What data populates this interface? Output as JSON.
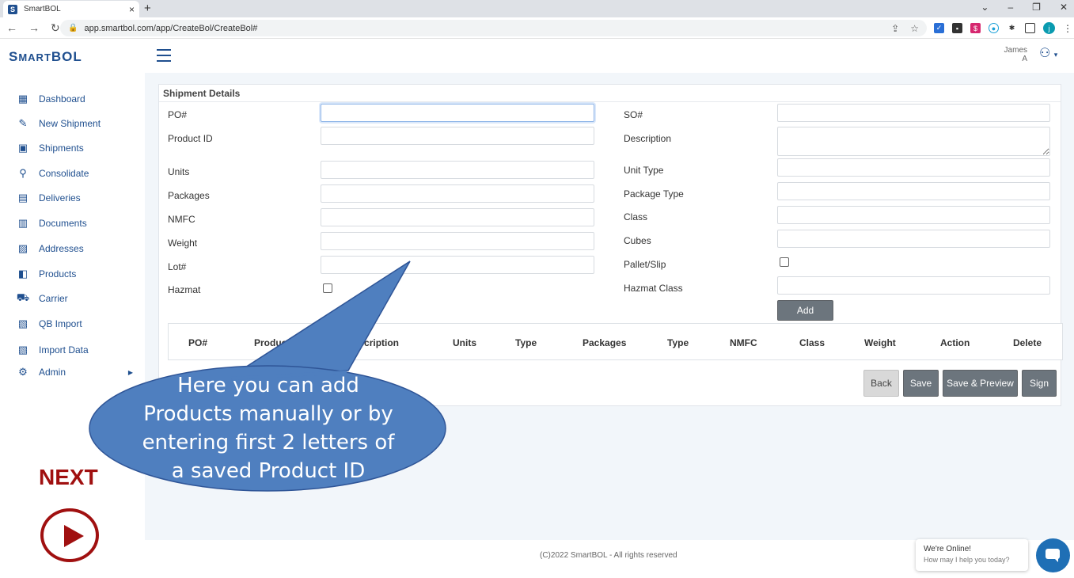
{
  "browser": {
    "tab_favicon": "S",
    "tab_title": "SmartBOL",
    "tab_close": "×",
    "new_tab": "+",
    "url": "app.smartbol.com/app/CreateBol/CreateBol#",
    "profile_initial": "j",
    "window_controls": [
      "⌄",
      "–",
      "❐",
      "✕"
    ]
  },
  "app": {
    "logo_first": "S",
    "logo_mid": "MART",
    "logo_last": "BOL",
    "user_first": "James",
    "user_last": "A"
  },
  "sidebar": {
    "items": [
      {
        "label": "Dashboard",
        "icon": "dashboard-icon",
        "glyph": "▦"
      },
      {
        "label": "New Shipment",
        "icon": "edit-icon",
        "glyph": "✎"
      },
      {
        "label": "Shipments",
        "icon": "boxes-icon",
        "glyph": "▣"
      },
      {
        "label": "Consolidate",
        "icon": "sitemap-icon",
        "glyph": "⚲"
      },
      {
        "label": "Deliveries",
        "icon": "calendar-icon",
        "glyph": "▤"
      },
      {
        "label": "Documents",
        "icon": "document-icon",
        "glyph": "▥"
      },
      {
        "label": "Addresses",
        "icon": "address-card-icon",
        "glyph": "▨"
      },
      {
        "label": "Products",
        "icon": "box-open-icon",
        "glyph": "◧"
      },
      {
        "label": "Carrier",
        "icon": "truck-icon",
        "glyph": "⛟"
      },
      {
        "label": "QB Import",
        "icon": "file-import-icon",
        "glyph": "▧"
      },
      {
        "label": "Import Data",
        "icon": "file-import-icon",
        "glyph": "▧"
      },
      {
        "label": "Admin",
        "icon": "users-cog-icon",
        "glyph": "⚙"
      }
    ],
    "next_label": "NEXT"
  },
  "form": {
    "title": "Shipment Details",
    "left": {
      "po": "PO#",
      "product_id": "Product ID",
      "units": "Units",
      "packages": "Packages",
      "nmfc": "NMFC",
      "weight": "Weight",
      "lot": "Lot#",
      "hazmat": "Hazmat"
    },
    "right": {
      "so": "SO#",
      "description": "Description",
      "unit_type": "Unit Type",
      "package_type": "Package Type",
      "class": "Class",
      "cubes": "Cubes",
      "pallet_slip": "Pallet/Slip",
      "hazmat_class": "Hazmat Class"
    },
    "add_button": "Add"
  },
  "table": {
    "headers": [
      "PO#",
      "Product Id",
      "Description",
      "Units",
      "Type",
      "Packages",
      "Type",
      "NMFC",
      "Class",
      "Weight",
      "Action",
      "Delete"
    ]
  },
  "actions": {
    "back": "Back",
    "save": "Save",
    "save_preview": "Save & Preview",
    "sign": "Sign"
  },
  "footer": {
    "text": "(C)2022 SmartBOL - All rights reserved"
  },
  "chat": {
    "title": "We're Online!",
    "subtitle": "How may I help you today?"
  },
  "callout": {
    "line1": "Here you can add",
    "line2": "Products manually or by",
    "line3": "entering first 2 letters of",
    "line4": "a saved Product ID"
  },
  "colors": {
    "brand": "#1f4f8f",
    "next": "#a01010",
    "callout_fill": "#4f7fbf",
    "callout_stroke": "#2f5597"
  }
}
